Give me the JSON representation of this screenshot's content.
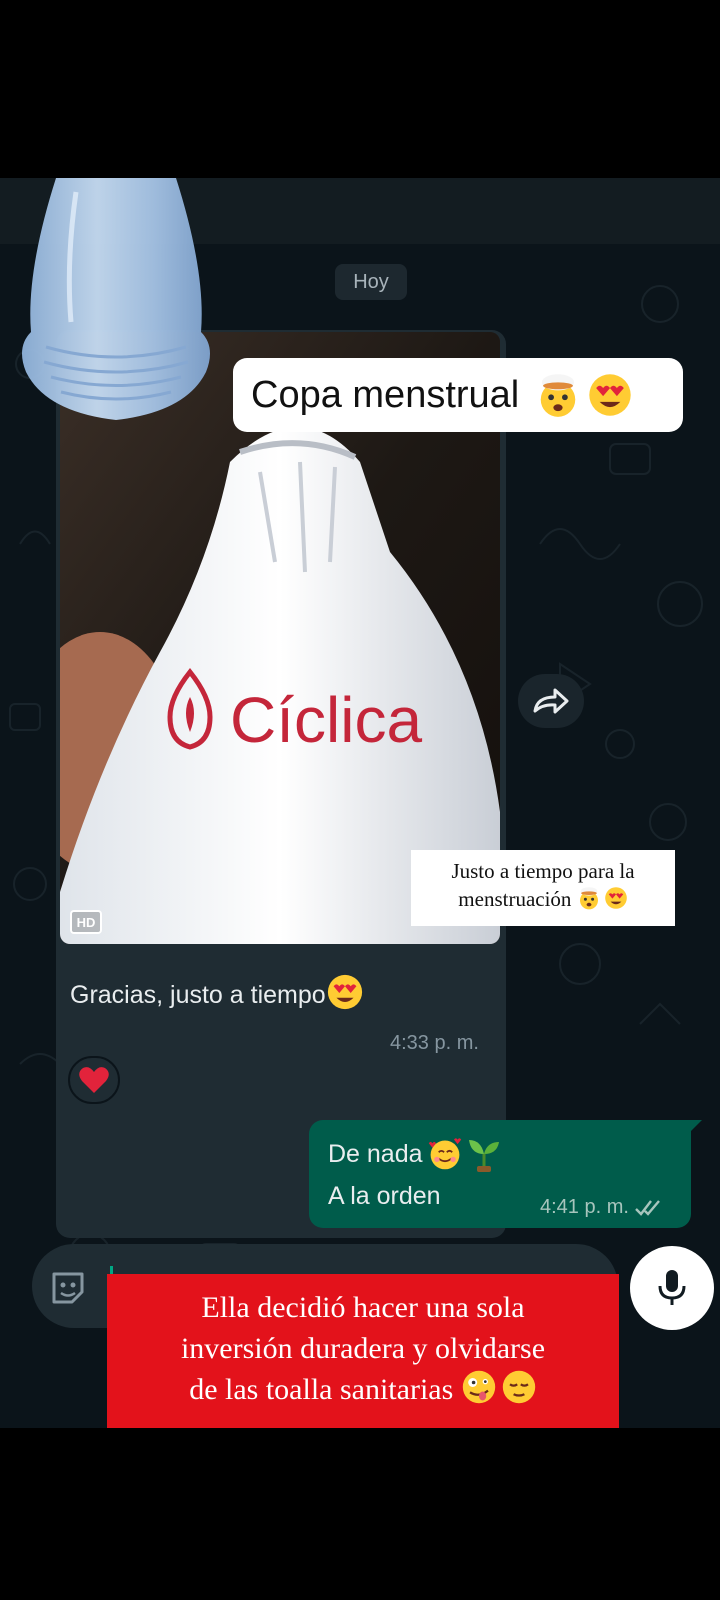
{
  "chat": {
    "date_separator": "Hoy",
    "incoming": {
      "image_brand_text": "Cíclica",
      "hd_badge": "HD",
      "caption": "Gracias, justo a tiempo",
      "time": "4:33 p. m.",
      "reaction_icon": "red-heart-emoji"
    },
    "outgoing": {
      "line1": "De nada",
      "line2": "A la orden",
      "time": "4:41 p. m.",
      "status_icon": "double-check-icon"
    },
    "input": {
      "left_icon": "sticker-icon",
      "mic_icon": "microphone-icon"
    },
    "forward_icon": "forward-arrow-icon"
  },
  "overlay": {
    "title_label": "Copa menstrual",
    "note_text_line1": "Justo a tiempo para la",
    "note_text_line2": "menstruación",
    "banner_line1": "Ella decidió hacer una sola",
    "banner_line2": "inversión duradera y olvidarse",
    "banner_line3": "de las toalla sanitarias"
  },
  "colors": {
    "chat_background": "#0b141a",
    "incoming_bubble": "#1f2c33",
    "outgoing_bubble": "#005c4b",
    "banner_red": "#e3121b",
    "brand_red": "#c4263a"
  }
}
